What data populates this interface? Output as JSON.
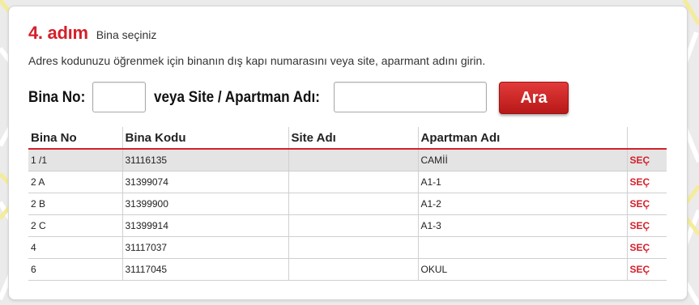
{
  "step": {
    "number": "4. adım",
    "subtitle": "Bina seçiniz"
  },
  "instructions": "Adres kodunuzu öğrenmek için binanın dış kapı numarasını veya site, aparmant adını girin.",
  "search": {
    "bina_no_label": "Bina No:",
    "bina_no_value": "",
    "site_label": "veya  Site / Apartman Adı:",
    "site_value": "",
    "button_label": "Ara"
  },
  "table": {
    "headers": [
      "Bina No",
      "Bina Kodu",
      "Site Adı",
      "Apartman Adı",
      ""
    ],
    "action_label": "SEÇ",
    "rows": [
      {
        "bina_no": "1 /1",
        "bina_kodu": "31116135",
        "site_adi": "",
        "apartman_adi": "CAMİİ",
        "selected": true
      },
      {
        "bina_no": "2 A",
        "bina_kodu": "31399074",
        "site_adi": "",
        "apartman_adi": "A1-1",
        "selected": false
      },
      {
        "bina_no": "2 B",
        "bina_kodu": "31399900",
        "site_adi": "",
        "apartman_adi": "A1-2",
        "selected": false
      },
      {
        "bina_no": "2 C",
        "bina_kodu": "31399914",
        "site_adi": "",
        "apartman_adi": "A1-3",
        "selected": false
      },
      {
        "bina_no": "4",
        "bina_kodu": "31117037",
        "site_adi": "",
        "apartman_adi": "",
        "selected": false
      },
      {
        "bina_no": "6",
        "bina_kodu": "31117045",
        "site_adi": "",
        "apartman_adi": "OKUL",
        "selected": false
      }
    ]
  },
  "colors": {
    "accent": "#d4202b",
    "selected_row": "#e4e4e4",
    "map_road": "#f5ee9c"
  }
}
